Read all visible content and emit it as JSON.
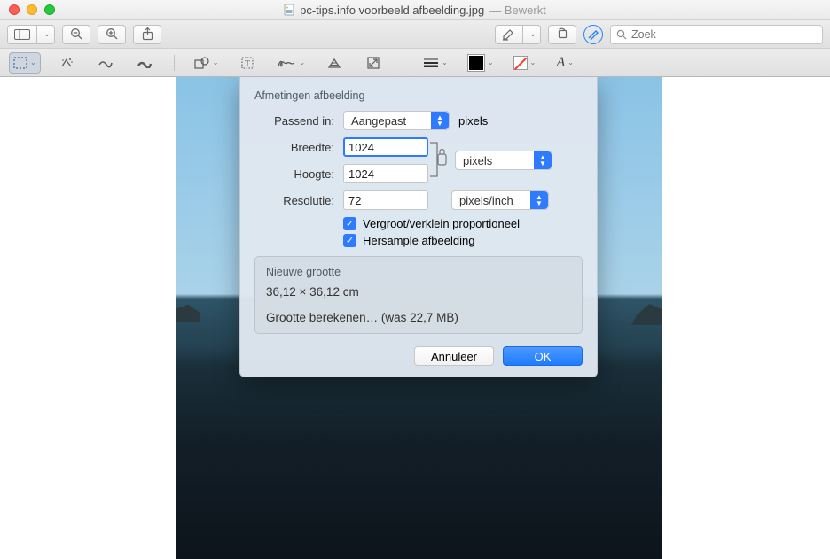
{
  "title": {
    "filename": "pc-tips.info voorbeeld afbeelding.jpg",
    "status": "Bewerkt"
  },
  "toolbar1": {
    "search_placeholder": "Zoek"
  },
  "dialog": {
    "section_dimensions": "Afmetingen afbeelding",
    "fit_label": "Passend in:",
    "fit_value": "Aangepast",
    "fit_unit": "pixels",
    "width_label": "Breedte:",
    "width_value": "1024",
    "height_label": "Hoogte:",
    "height_value": "1024",
    "wh_unit": "pixels",
    "res_label": "Resolutie:",
    "res_value": "72",
    "res_unit": "pixels/inch",
    "check_proportional": "Vergroot/verklein proportioneel",
    "check_resample": "Hersample afbeelding",
    "new_size_header": "Nieuwe grootte",
    "new_size_value": "36,12 × 36,12 cm",
    "calc_text": "Grootte berekenen… (was 22,7 MB)",
    "cancel": "Annuleer",
    "ok": "OK"
  }
}
